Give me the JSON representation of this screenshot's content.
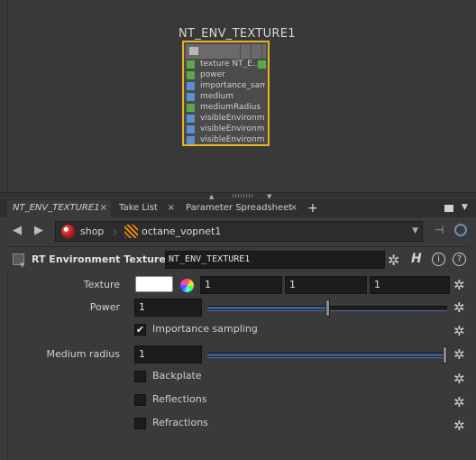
{
  "node_graph": {
    "node_title": "NT_ENV_TEXTURE1",
    "ports": [
      {
        "label": "texture  NT_E...",
        "color": "green",
        "has_output": true
      },
      {
        "label": "power",
        "color": "green",
        "has_output": false
      },
      {
        "label": "importance_sam...",
        "color": "blue",
        "has_output": false
      },
      {
        "label": "medium",
        "color": "blue",
        "has_output": false
      },
      {
        "label": "mediumRadius",
        "color": "green",
        "has_output": false
      },
      {
        "label": "visibleEnvironm...",
        "color": "blue",
        "has_output": false
      },
      {
        "label": "visibleEnvironm...",
        "color": "blue",
        "has_output": false
      },
      {
        "label": "visibleEnvironm...",
        "color": "blue",
        "has_output": false
      }
    ]
  },
  "tabs": [
    {
      "label": "NT_ENV_TEXTURE1",
      "active": true
    },
    {
      "label": "Take List",
      "active": false
    },
    {
      "label": "Parameter Spreadsheet",
      "active": false
    }
  ],
  "path": {
    "segments": [
      "shop",
      "octane_vopnet1"
    ]
  },
  "op_header": {
    "type_label": "RT Environment Texture",
    "node_name": "NT_ENV_TEXTURE1",
    "h_label": "H",
    "info_label": "i",
    "help_label": "?"
  },
  "params": {
    "texture": {
      "label": "Texture",
      "color": "#ffffff",
      "values": [
        "1",
        "1",
        "1"
      ]
    },
    "power": {
      "label": "Power",
      "value": "1",
      "slider_fraction": 0.5
    },
    "importance_sampling": {
      "label": "Importance sampling",
      "checked": true
    },
    "medium_radius": {
      "label": "Medium radius",
      "value": "1",
      "slider_fraction": 1.0
    },
    "backplate": {
      "label": "Backplate",
      "checked": false
    },
    "reflections": {
      "label": "Reflections",
      "checked": false
    },
    "refractions": {
      "label": "Refractions",
      "checked": false
    }
  },
  "icons": {
    "back": "◀",
    "forward": "▶",
    "gear": "✲",
    "close": "×",
    "add": "+",
    "dropdown": "▼",
    "check": "✔",
    "pin": "⊣"
  }
}
